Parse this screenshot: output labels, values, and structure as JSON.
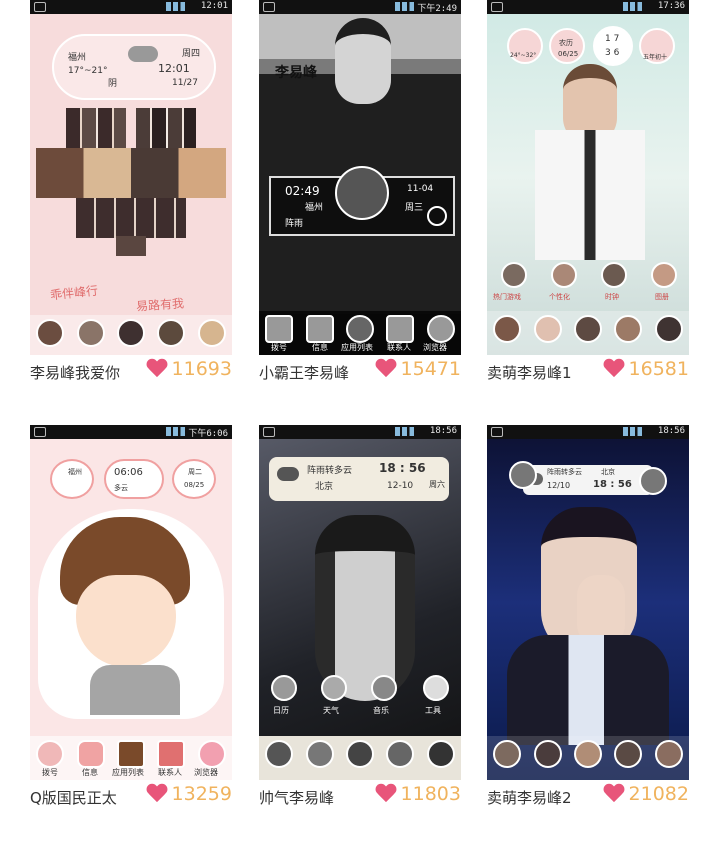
{
  "themes": [
    {
      "name": "李易峰我爱你",
      "likes": "11693",
      "status_time": "12:01",
      "widget": {
        "city": "福州",
        "temp": "17°~21°",
        "weather": "阴",
        "weekday": "周四",
        "time": "12:01",
        "date": "11/27"
      },
      "slogan_left": "乖伴峰行",
      "slogan_right": "易路有我"
    },
    {
      "name": "小霸王李易峰",
      "likes": "15471",
      "status_time": "下午2:49",
      "banner": "李易峰",
      "widget": {
        "time": "02:49",
        "city": "福州",
        "weather": "阵雨",
        "date": "11-04",
        "weekday": "周三"
      },
      "dock": [
        "拨号",
        "信息",
        "应用列表",
        "联系人",
        "浏览器"
      ]
    },
    {
      "name": "卖萌李易峰1",
      "likes": "16581",
      "status_time": "17:36",
      "widget": {
        "weather_range": "24°~32°",
        "slot2_top": "农历",
        "slot2_bottom": "06/25",
        "time_top": "1 7",
        "time_bottom": "3 6",
        "weekday": "五年初十"
      },
      "icons": [
        "热门游戏",
        "个性化",
        "时钟",
        "图册"
      ]
    },
    {
      "name": "Q版国民正太",
      "likes": "13259",
      "status_time": "下午6:06",
      "widget": {
        "city": "福州",
        "time": "06:06",
        "weather": "多云",
        "weekday": "周二",
        "date": "08/25"
      },
      "dock": [
        "拨号",
        "信息",
        "应用列表",
        "联系人",
        "浏览器"
      ]
    },
    {
      "name": "帅气李易峰",
      "likes": "11803",
      "status_time": "18:56",
      "widget": {
        "weather": "阵雨转多云",
        "city": "北京",
        "time": "18 : 56",
        "date": "12-10",
        "weekday": "周六"
      },
      "icons": [
        "日历",
        "天气",
        "音乐",
        "工具"
      ]
    },
    {
      "name": "卖萌李易峰2",
      "likes": "21082",
      "status_time": "18:56",
      "widget": {
        "weather": "阵雨转多云",
        "city": "北京",
        "date": "12/10",
        "time": "18 : 56"
      }
    }
  ],
  "colors": {
    "heart": "#e8557a",
    "count": "#f0b35e",
    "pink_bg": "#f7dcdc"
  }
}
